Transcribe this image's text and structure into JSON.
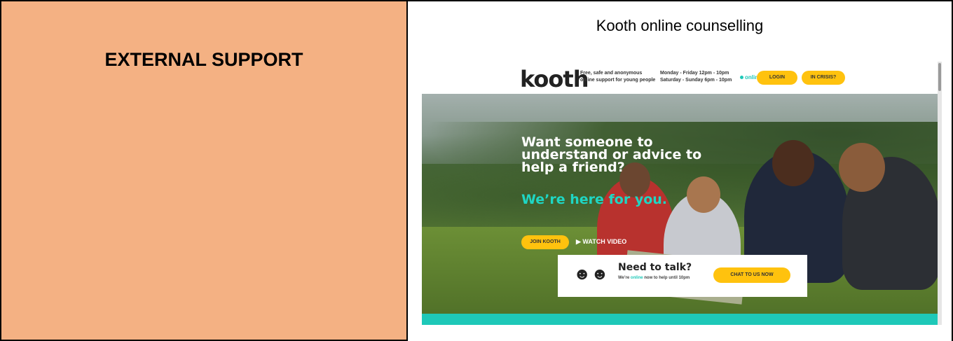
{
  "left": {
    "heading": "EXTERNAL SUPPORT"
  },
  "right": {
    "heading": "Kooth online counselling"
  },
  "site": {
    "logo": "kooth",
    "tagline": "Free, safe and anonymous online support for young people",
    "hours_weekday": "Monday - Friday    12pm - 10pm",
    "hours_weekend": "Saturday - Sunday   6pm - 10pm",
    "online_status": "online",
    "login_label": "LOGIN",
    "crisis_label": "IN CRISIS?",
    "headline": "Want someone to understand or advice to help a friend?",
    "subheadline": "We’re here for you.",
    "join_label": "JOIN KOOTH",
    "watch_label": "WATCH VIDEO",
    "card": {
      "title": "Need to talk?",
      "text_before": "We’re ",
      "text_online": "online",
      "text_after": " now to help until 10pm",
      "chat_label": "CHAT TO US NOW"
    }
  },
  "colors": {
    "panel": "#f4b183",
    "accent": "#ffc20e",
    "teal": "#1ec8b8"
  }
}
